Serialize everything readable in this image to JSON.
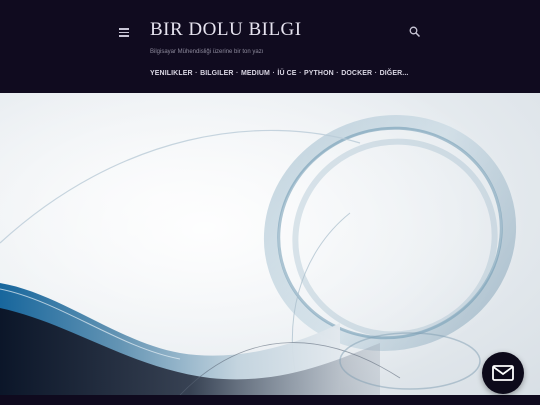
{
  "header": {
    "title": "BIR DOLU BILGI",
    "description": "Bilgisayar Mühendisliği üzerine bir ton yazı",
    "menu_icon": "hamburger-menu-icon",
    "search_icon": "search-icon"
  },
  "nav": {
    "items": [
      "YENILIKLER",
      "BILGILER",
      "MEDIUM",
      "İÜ CE",
      "PYTHON",
      "DOCKER",
      "DIĞER..."
    ],
    "separator": "·"
  },
  "hero": {
    "image": "abstract-blue-swirl-background"
  },
  "fab": {
    "icon": "mail-icon"
  },
  "colors": {
    "header_bg": "#100b1f",
    "title": "#e6e3ef",
    "nav_text": "#d9d6e3",
    "accent_blue": "#2c6f9a"
  }
}
